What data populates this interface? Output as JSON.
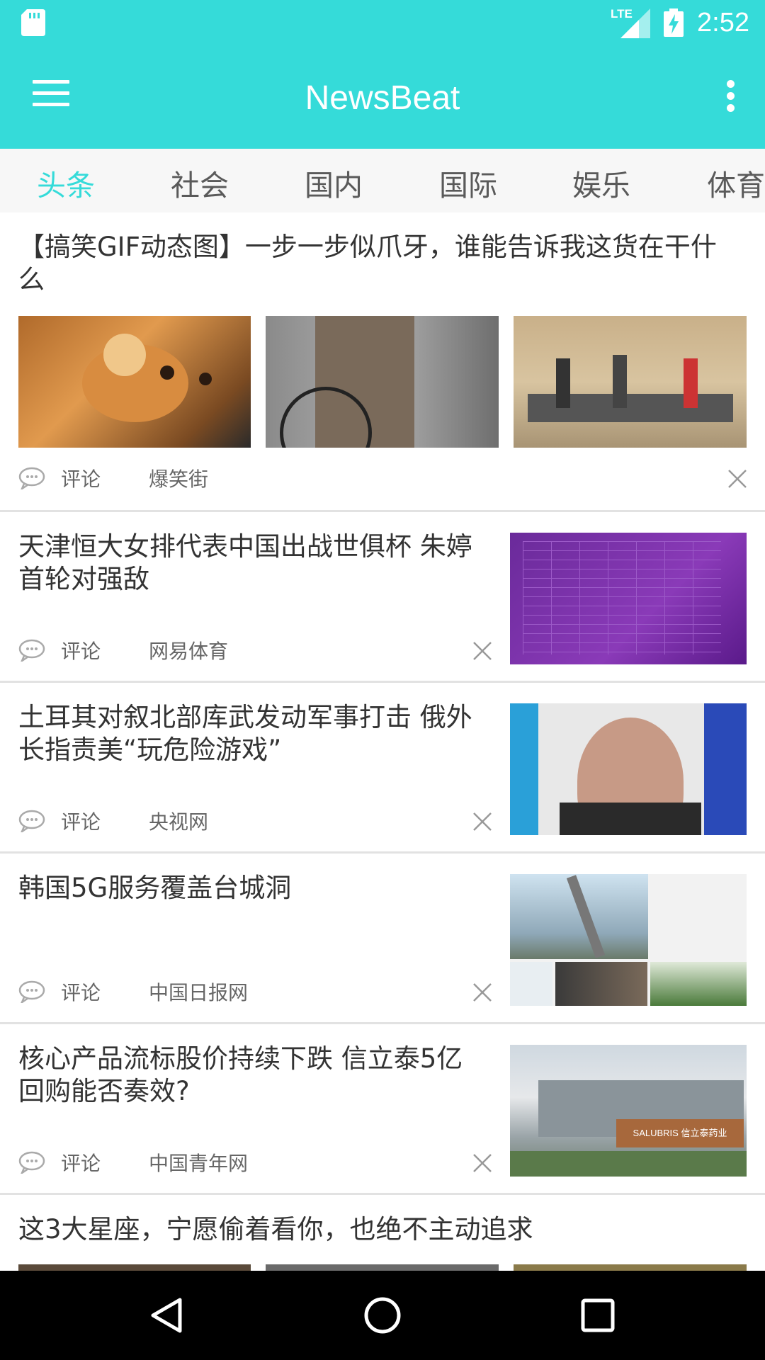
{
  "status_bar": {
    "time": "2:52",
    "network": "LTE"
  },
  "app_bar": {
    "title": "NewsBeat"
  },
  "tabs": [
    {
      "label": "头条",
      "active": true
    },
    {
      "label": "社会",
      "active": false
    },
    {
      "label": "国内",
      "active": false
    },
    {
      "label": "国际",
      "active": false
    },
    {
      "label": "娱乐",
      "active": false
    },
    {
      "label": "体育",
      "active": false
    }
  ],
  "articles": [
    {
      "title": "【搞笑GIF动态图】一步一步似爪牙，谁能告诉我这货在干什么",
      "comment_label": "评论",
      "source": "爆笑街",
      "layout": "three-images"
    },
    {
      "title": "天津恒大女排代表中国出战世俱杯 朱婷首轮对强敌",
      "comment_label": "评论",
      "source": "网易体育",
      "layout": "right-image"
    },
    {
      "title": "土耳其对叙北部库武发动军事打击 俄外长指责美“玩危险游戏”",
      "comment_label": "评论",
      "source": "央视网",
      "layout": "right-image"
    },
    {
      "title": "韩国5G服务覆盖台城洞",
      "comment_label": "评论",
      "source": "中国日报网",
      "layout": "right-image"
    },
    {
      "title": "核心产品流标股价持续下跌 信立泰5亿回购能否奏效?",
      "comment_label": "评论",
      "source": "中国青年网",
      "layout": "right-image"
    },
    {
      "title": "这3大星座，宁愿偷着看你，也绝不主动追求",
      "layout": "three-images"
    }
  ],
  "colors": {
    "accent": "#35DBD9",
    "text": "#333333",
    "meta": "#666666",
    "tab_bg": "#f7f7f7"
  },
  "thumbnail_text": {
    "salubris_sign": "SALUBRIS 信立泰药业"
  }
}
